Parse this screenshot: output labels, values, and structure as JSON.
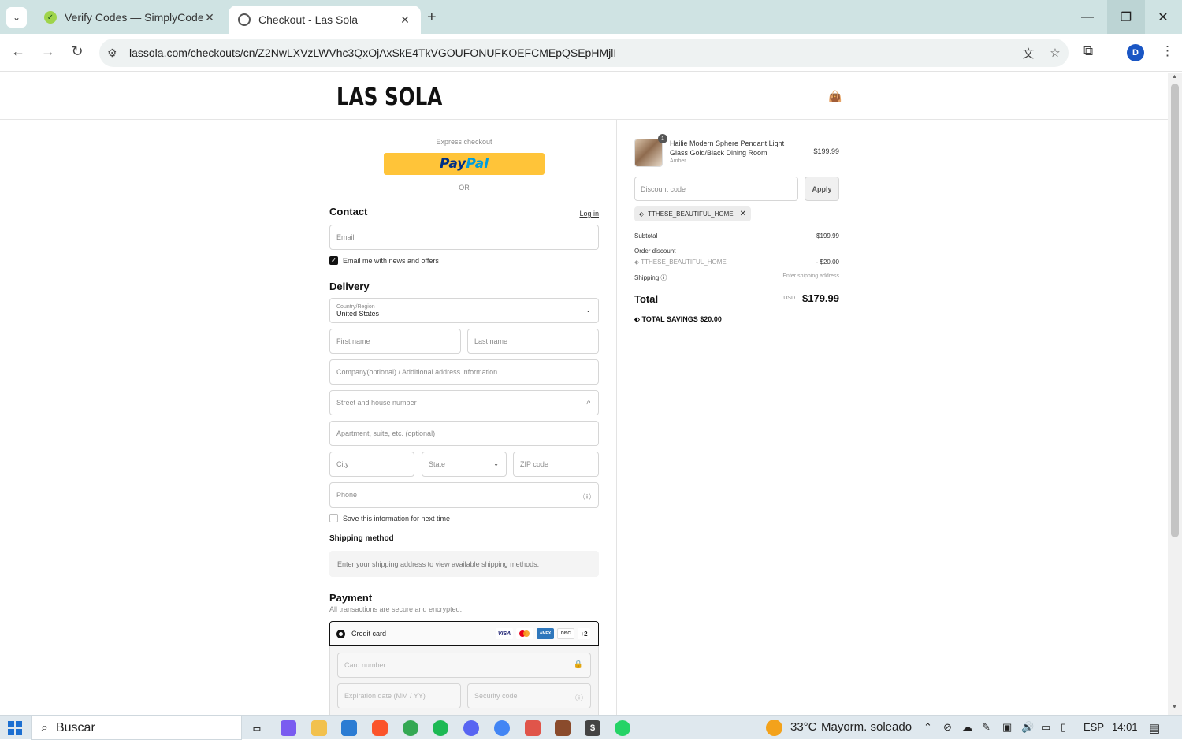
{
  "browser": {
    "tabs": [
      {
        "title": "Verify Codes — SimplyCodes",
        "active": false
      },
      {
        "title": "Checkout - Las Sola",
        "active": true
      }
    ],
    "url": "lassola.com/checkouts/cn/Z2NwLXVzLWVhc3QxOjAxSkE4TkVGOUFONUFKOEFCMEpQSEpHMjlI",
    "profile_initial": "D"
  },
  "site": {
    "logo": "LAS SOLA"
  },
  "checkout": {
    "express_label": "Express checkout",
    "paypal_pay": "Pay",
    "paypal_pal": "Pal",
    "or_label": "OR",
    "contact_title": "Contact",
    "login_link": "Log in",
    "email_placeholder": "Email",
    "email_news_label": "Email me with news and offers",
    "delivery_title": "Delivery",
    "country_label": "Country/Region",
    "country_value": "United States",
    "first_name": "First name",
    "last_name": "Last name",
    "company": "Company(optional) / Additional address information",
    "street": "Street and house number",
    "apartment": "Apartment, suite, etc. (optional)",
    "city": "City",
    "state": "State",
    "zip": "ZIP code",
    "phone": "Phone",
    "save_info_label": "Save this information for next time",
    "shipping_method_title": "Shipping method",
    "shipping_method_msg": "Enter your shipping address to view available shipping methods.",
    "payment_title": "Payment",
    "payment_sub": "All transactions are secure and encrypted.",
    "credit_card_label": "Credit card",
    "card_more": "+2",
    "card_number": "Card number",
    "expiration": "Expiration date (MM / YY)",
    "security_code": "Security code"
  },
  "summary": {
    "product_qty": "1",
    "product_name": "Hailie Modern Sphere Pendant Light Glass Gold/Black Dining Room",
    "product_variant": "Amber",
    "product_price": "$199.99",
    "discount_placeholder": "Discount code",
    "apply_label": "Apply",
    "applied_code": "TTHESE_BEAUTIFUL_HOME",
    "subtotal_label": "Subtotal",
    "subtotal_value": "$199.99",
    "order_discount_label": "Order discount",
    "order_discount_code": "TTHESE_BEAUTIFUL_HOME",
    "order_discount_value": "- $20.00",
    "shipping_label": "Shipping",
    "shipping_value": "Enter shipping address",
    "total_label": "Total",
    "currency": "USD",
    "total_value": "$179.99",
    "savings_label": "TOTAL SAVINGS",
    "savings_value": "$20.00"
  },
  "taskbar": {
    "search_label": "Buscar",
    "temperature": "33°C",
    "weather": "Mayorm. soleado",
    "language": "ESP",
    "time": "14:01"
  }
}
